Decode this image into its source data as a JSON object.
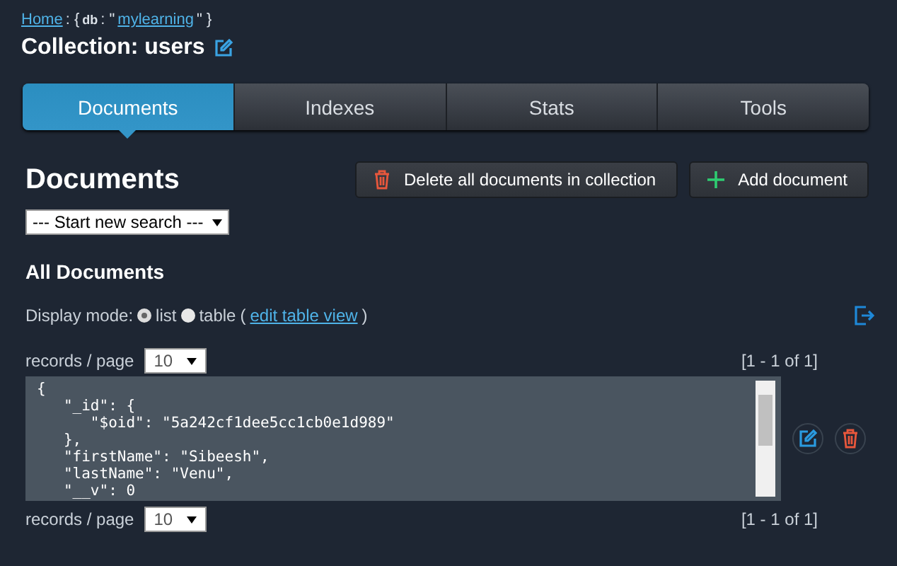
{
  "breadcrumb": {
    "home": "Home",
    "sep1": ": {",
    "db_key": "db",
    "sep2": ": \"",
    "db_name": "mylearning",
    "sep3": "\" }"
  },
  "collection_title": "Collection: users",
  "tabs": [
    {
      "label": "Documents",
      "selected": true
    },
    {
      "label": "Indexes",
      "selected": false
    },
    {
      "label": "Stats",
      "selected": false
    },
    {
      "label": "Tools",
      "selected": false
    }
  ],
  "section_title": "Documents",
  "actions": [
    {
      "kind": "delete",
      "label": "Delete all documents in collection"
    },
    {
      "kind": "add",
      "label": "Add document"
    }
  ],
  "search_select": {
    "value": "--- Start new search ---"
  },
  "list_title": "All Documents",
  "display_mode": {
    "label": "Display mode:",
    "options": [
      {
        "label": "list",
        "selected": true
      },
      {
        "label": "table",
        "selected": false
      }
    ],
    "paren_open": "(",
    "link": "edit table view",
    "paren_close": ")"
  },
  "pager_top": {
    "label": "records / page",
    "value": "10",
    "range": "[1 - 1 of 1]"
  },
  "document": "{\n   \"_id\": {\n      \"$oid\": \"5a242cf1dee5cc1cb0e1d989\"\n   },\n   \"firstName\": \"Sibeesh\",\n   \"lastName\": \"Venu\",\n   \"__v\": 0",
  "pager_bottom": {
    "label": "records / page",
    "value": "10",
    "range": "[1 - 1 of 1]"
  }
}
